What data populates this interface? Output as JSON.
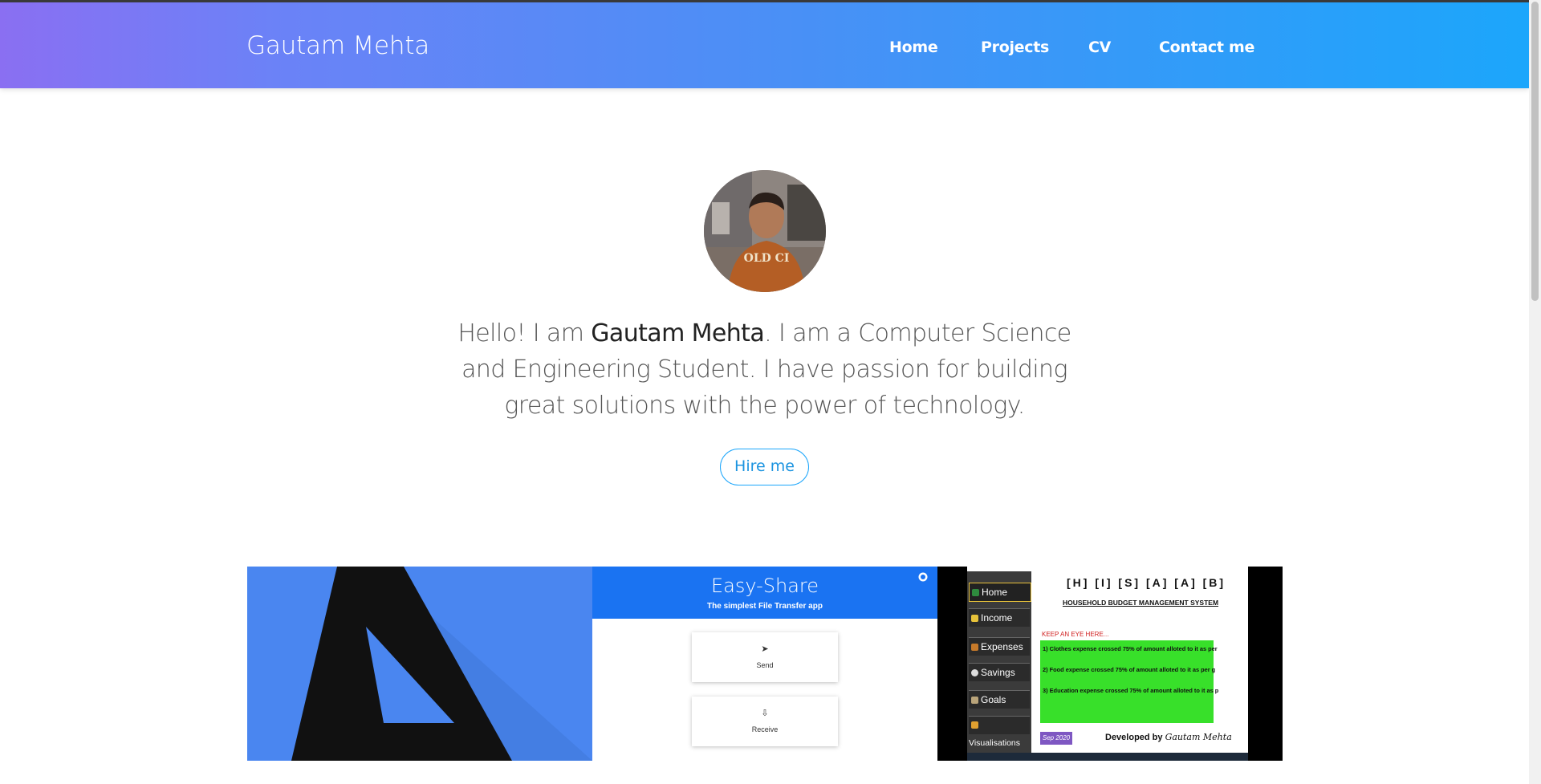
{
  "navbar": {
    "brand": "Gautam Mehta",
    "links": [
      "Home",
      "Projects",
      "CV",
      "Contact me"
    ]
  },
  "hero": {
    "intro_prefix": "Hello! I am ",
    "intro_name": "Gautam Mehta",
    "intro_suffix": ". I am a Computer Science and Engineering Student. I have passion for building great solutions with the power of technology.",
    "hire_button": "Hire me",
    "avatar_shirt_text": "OLD CI"
  },
  "projects": {
    "easy_share": {
      "title": "Easy-Share",
      "subtitle": "The simplest File Transfer app",
      "send_label": "Send",
      "receive_label": "Receive"
    },
    "budget": {
      "letters": "[H] [I] [S] [A] [A] [B]",
      "title": "HOUSEHOLD BUDGET MANAGEMENT SYSTEM",
      "alert": "KEEP AN EYE HERE...",
      "lines": [
        "1) Clothes expense crossed 75% of amount alloted to it as per",
        "2) Food expense crossed 75% of amount alloted to it as per g",
        "3) Education expense crossed 75% of amount alloted to it as p"
      ],
      "menu": [
        "Home",
        "Income",
        "Expenses",
        "Savings",
        "Goals",
        "Visualisations"
      ],
      "badge": "Sep 2020",
      "developed_by_prefix": "Developed by ",
      "developed_by_name": "Gautam Mehta"
    }
  },
  "colors": {
    "nav_gradient_start": "#8a6ff2",
    "nav_gradient_end": "#1ca6fb",
    "accent": "#1ca6fb"
  }
}
